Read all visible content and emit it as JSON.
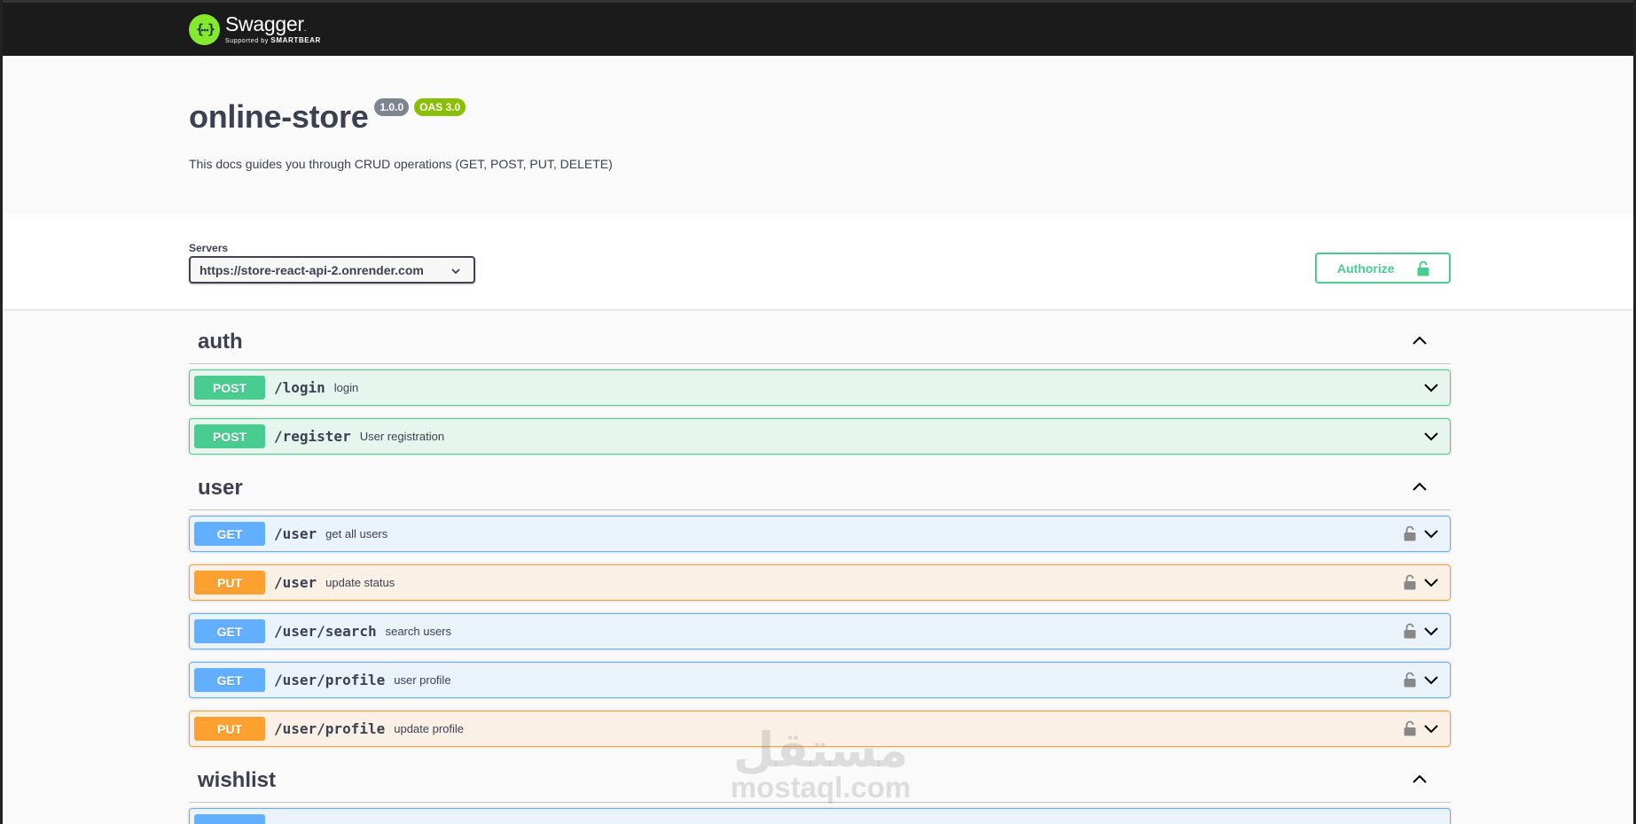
{
  "topbar": {
    "logo_icon": "swagger-braces-icon",
    "brand": "Swagger",
    "tm": ".",
    "supported_by": "Supported by",
    "smartbear": "SMARTBEAR"
  },
  "info": {
    "title": "online-store",
    "version_badge": "1.0.0",
    "oas_badge": "OAS 3.0",
    "description": "This docs guides you through CRUD operations (GET, POST, PUT, DELETE)"
  },
  "servers": {
    "label": "Servers",
    "selected": "https://store-react-api-2.onrender.com"
  },
  "authorize": {
    "label": "Authorize",
    "icon": "unlock-icon"
  },
  "tags": [
    {
      "name": "auth",
      "operations": [
        {
          "method": "POST",
          "path": "/login",
          "summary": "login",
          "locked": false
        },
        {
          "method": "POST",
          "path": "/register",
          "summary": "User registration",
          "locked": false
        }
      ]
    },
    {
      "name": "user",
      "operations": [
        {
          "method": "GET",
          "path": "/user",
          "summary": "get all users",
          "locked": true
        },
        {
          "method": "PUT",
          "path": "/user",
          "summary": "update status",
          "locked": true
        },
        {
          "method": "GET",
          "path": "/user/search",
          "summary": "search users",
          "locked": true
        },
        {
          "method": "GET",
          "path": "/user/profile",
          "summary": "user profile",
          "locked": true
        },
        {
          "method": "PUT",
          "path": "/user/profile",
          "summary": "update profile",
          "locked": true
        }
      ]
    },
    {
      "name": "wishlist",
      "operations": []
    }
  ],
  "watermark": {
    "arabic": "مستقل",
    "latin": "mostaql.com"
  },
  "colors": {
    "post": "#49cc90",
    "get": "#61affe",
    "put": "#fca130",
    "topbar": "#1b1b1b",
    "logo": "#85ea2d"
  }
}
